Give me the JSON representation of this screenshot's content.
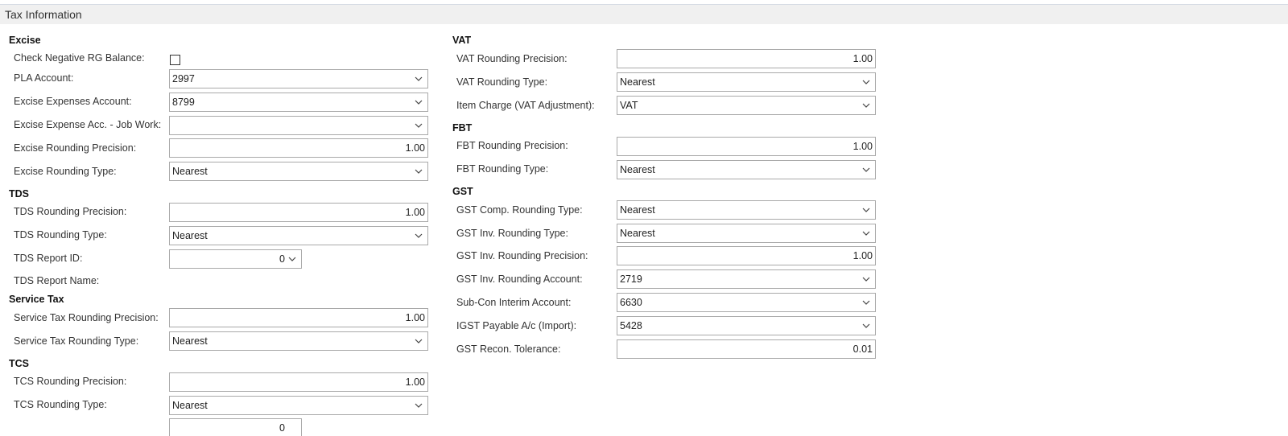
{
  "header": {
    "title": "Tax Information"
  },
  "excise": {
    "heading": "Excise",
    "check_negative_label": "Check Negative RG Balance:",
    "pla_label": "PLA Account:",
    "pla_value": "2997",
    "expenses_label": "Excise Expenses Account:",
    "expenses_value": "8799",
    "jobwork_label": "Excise Expense Acc. - Job Work:",
    "jobwork_value": "",
    "rounding_precision_label": "Excise Rounding Precision:",
    "rounding_precision_value": "1.00",
    "rounding_type_label": "Excise Rounding Type:",
    "rounding_type_value": "Nearest"
  },
  "tds": {
    "heading": "TDS",
    "rounding_precision_label": "TDS Rounding Precision:",
    "rounding_precision_value": "1.00",
    "rounding_type_label": "TDS Rounding Type:",
    "rounding_type_value": "Nearest",
    "report_id_label": "TDS Report ID:",
    "report_id_value": "0",
    "report_name_label": "TDS Report Name:"
  },
  "service_tax": {
    "heading": "Service Tax",
    "rounding_precision_label": "Service Tax Rounding Precision:",
    "rounding_precision_value": "1.00",
    "rounding_type_label": "Service Tax Rounding Type:",
    "rounding_type_value": "Nearest"
  },
  "tcs": {
    "heading": "TCS",
    "rounding_precision_label": "TCS Rounding Precision:",
    "rounding_precision_value": "1.00",
    "rounding_type_label": "TCS Rounding Type:",
    "rounding_type_value": "Nearest",
    "report_id_value": "0"
  },
  "vat": {
    "heading": "VAT",
    "rounding_precision_label": "VAT Rounding Precision:",
    "rounding_precision_value": "1.00",
    "rounding_type_label": "VAT Rounding Type:",
    "rounding_type_value": "Nearest",
    "item_charge_label": "Item Charge (VAT Adjustment):",
    "item_charge_value": "VAT"
  },
  "fbt": {
    "heading": "FBT",
    "rounding_precision_label": "FBT Rounding Precision:",
    "rounding_precision_value": "1.00",
    "rounding_type_label": "FBT Rounding Type:",
    "rounding_type_value": "Nearest"
  },
  "gst": {
    "heading": "GST",
    "comp_rounding_type_label": "GST Comp. Rounding Type:",
    "comp_rounding_type_value": "Nearest",
    "inv_rounding_type_label": "GST Inv. Rounding Type:",
    "inv_rounding_type_value": "Nearest",
    "inv_rounding_precision_label": "GST Inv. Rounding Precision:",
    "inv_rounding_precision_value": "1.00",
    "inv_rounding_account_label": "GST Inv. Rounding Account:",
    "inv_rounding_account_value": "2719",
    "subcon_label": "Sub-Con Interim Account:",
    "subcon_value": "6630",
    "igst_label": "IGST Payable A/c (Import):",
    "igst_value": "5428",
    "recon_label": "GST Recon. Tolerance:",
    "recon_value": "0.01"
  },
  "icons": {
    "dropdown": "chevron-down-icon"
  }
}
